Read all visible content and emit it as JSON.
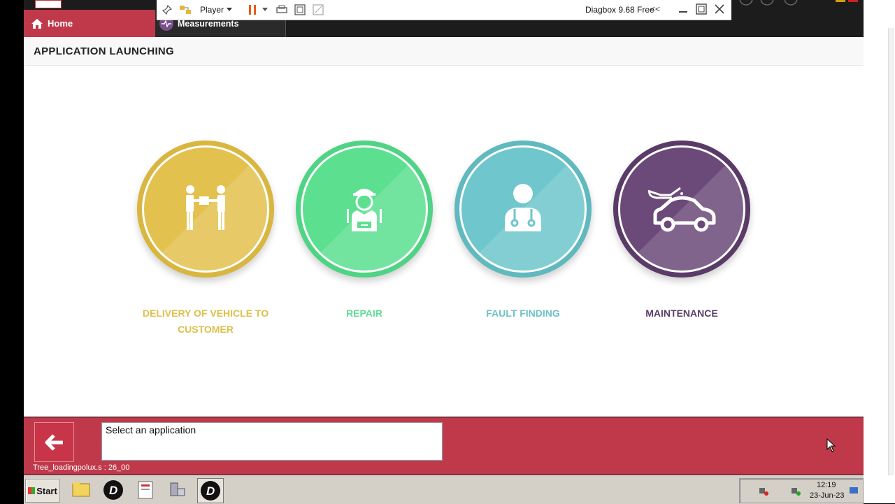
{
  "header": {
    "home_tab": "Home",
    "measurements_tab": "Measurements"
  },
  "player_toolbar": {
    "player_label": "Player",
    "window_title": "Diagbox 9.68 Free"
  },
  "page": {
    "title": "APPLICATION LAUNCHING"
  },
  "applications": [
    {
      "label": "DELIVERY OF VEHICLE TO CUSTOMER",
      "color": "#e3c14e",
      "icon": "handover-icon"
    },
    {
      "label": "REPAIR",
      "color": "#5ce08f",
      "icon": "mechanic-icon"
    },
    {
      "label": "FAULT FINDING",
      "color": "#6fc6cc",
      "icon": "doctor-icon"
    },
    {
      "label": "MAINTENANCE",
      "color": "#6b4a79",
      "icon": "car-oil-icon"
    }
  ],
  "bottom": {
    "message": "Select an application",
    "status": "Tree_loadingpolux.s : 26_00"
  },
  "taskbar": {
    "start_label": "Start",
    "time": "12:19",
    "date": "23-Jun-23"
  },
  "colors": {
    "accent_red": "#c0394b",
    "header_dark": "#1c1c1c"
  }
}
